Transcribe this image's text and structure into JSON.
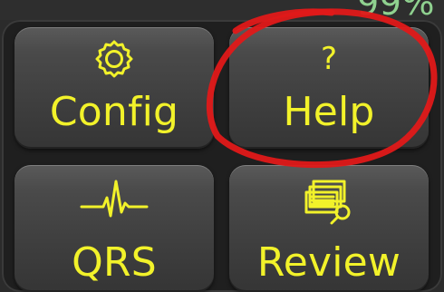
{
  "status": {
    "battery_text": "99%",
    "battery_color": "#8fd18f"
  },
  "menu": {
    "buttons": [
      {
        "label": "Config",
        "icon": "gear-icon"
      },
      {
        "label": "Help",
        "icon": "question-icon"
      },
      {
        "label": "QRS",
        "icon": "ecg-waveform-icon"
      },
      {
        "label": "Review",
        "icon": "monitor-review-icon"
      }
    ],
    "help_glyph": "?"
  },
  "colors": {
    "accent_text": "#f2f22a",
    "annotation_red": "#e01919",
    "panel_bg": "#1f1f1f",
    "tile_top": "#5a5a5a",
    "tile_bottom": "#353535"
  }
}
